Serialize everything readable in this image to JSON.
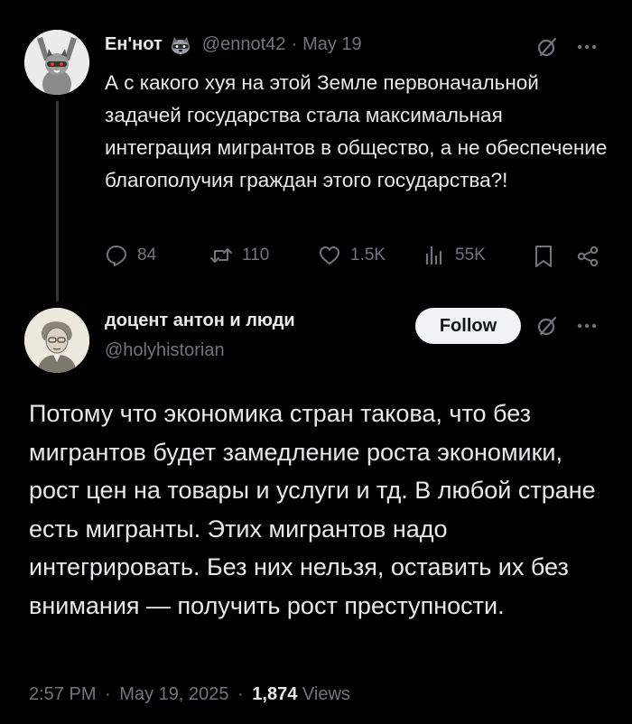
{
  "tweet1": {
    "display_name": "Ен'нот",
    "handle": "@ennot42",
    "separator": "·",
    "date": "May 19",
    "text": "А с какого хуя на этой Земле первоначальной задачей государства стала максимальная интеграция мигрантов в общество, а не обеспечение благополучия граждан этого государства?!",
    "stats": {
      "replies": "84",
      "reposts": "110",
      "likes": "1.5K",
      "views": "55K"
    }
  },
  "tweet2": {
    "display_name": "доцент антон и люди",
    "handle": "@holyhistorian",
    "follow_label": "Follow",
    "text": "Потому что экономика стран такова, что без мигрантов будет замедление роста экономики, рост цен на товары и услуги и тд. В любой стране есть мигранты. Этих мигрантов надо интегрировать. Без них нельзя, оставить их без внимания — получить рост преступности.",
    "time": "2:57 PM",
    "separator1": "·",
    "date": "May 19, 2025",
    "separator2": "·",
    "views_count": "1,874",
    "views_label": "Views"
  },
  "icons": {
    "more": "more-icon",
    "grok": "grok-icon",
    "reply": "reply-icon",
    "repost": "repost-icon",
    "like": "like-icon",
    "views": "views-icon",
    "bookmark": "bookmark-icon",
    "share": "share-icon",
    "raccoon_badge": "raccoon-emoji-icon"
  }
}
